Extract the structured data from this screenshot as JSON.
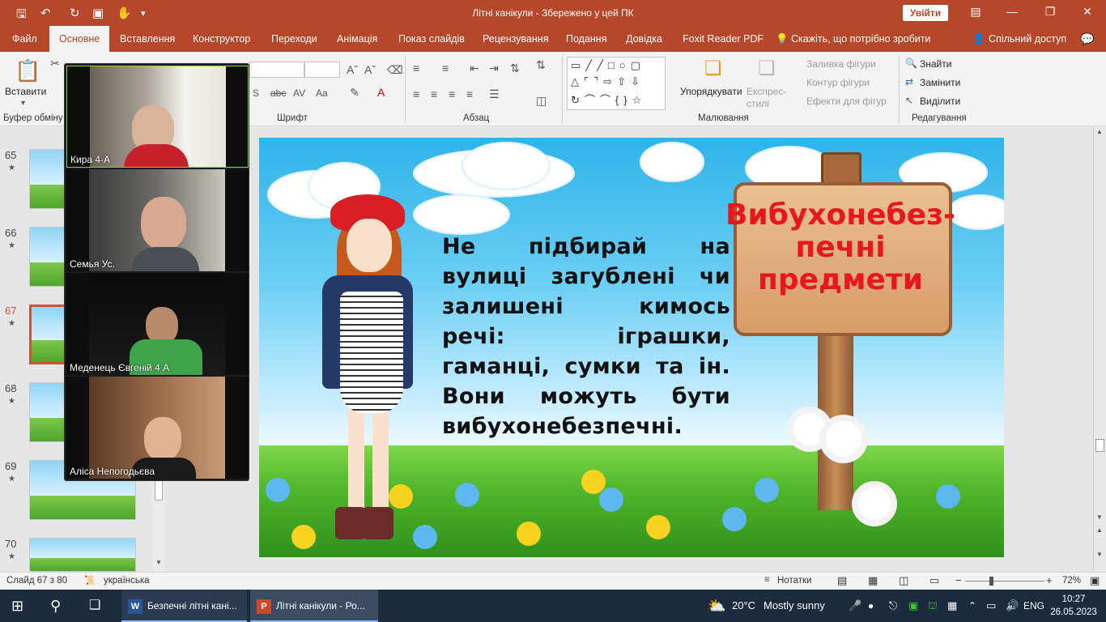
{
  "titlebar": {
    "title": "Літні канікули  -  Збережено у цей ПК",
    "signin_label": "Увійти"
  },
  "tabs": [
    "Файл",
    "Основне",
    "Вставлення",
    "Конструктор",
    "Переходи",
    "Анімація",
    "Показ слайдів",
    "Рецензування",
    "Подання",
    "Довідка",
    "Foxit Reader PDF",
    "Скажіть, що потрібно зробити",
    "Спільний доступ"
  ],
  "ribbon": {
    "paste_label": "Вставити",
    "clipboard_label": "Буфер обміну",
    "font_group": "Шрифт",
    "paragraph_group": "Абзац",
    "drawing_group": "Малювання",
    "editing_group": "Редагування",
    "arrange_label": "Упорядкувати",
    "quick_styles_label": "Експрес-стилі",
    "shape_fill": "Заливка фігури",
    "shape_outline": "Контур фігури",
    "shape_effects": "Ефекти для фігур",
    "find": "Знайти",
    "replace": "Замінити",
    "select": "Виділити"
  },
  "slides": [
    {
      "num": "65"
    },
    {
      "num": "66"
    },
    {
      "num": "67"
    },
    {
      "num": "68"
    },
    {
      "num": "69"
    },
    {
      "num": "70"
    }
  ],
  "slide": {
    "body_text": "Не підбирай на вулиці загублені чи залишені кимось речі: іграшки, гаманці, сумки та ін. Вони можуть бути вибухонебезпечні.",
    "sign_line1": "Вибухонебез-",
    "sign_line2": "печні",
    "sign_line3": "предмети"
  },
  "video": {
    "participants": [
      {
        "name": "Кира 4-А"
      },
      {
        "name": "Семья Ус."
      },
      {
        "name": "Меденець Євгеній 4 А"
      },
      {
        "name": "Аліса Непогодьєва"
      }
    ]
  },
  "status": {
    "slide_count": "Слайд 67 з 80",
    "language": "українська",
    "notes": "Нотатки",
    "zoom": "72%"
  },
  "taskbar": {
    "app1": "Безпечні літні кані...",
    "app2": "Літні канікули - Ро...",
    "weather_temp": "20°C",
    "weather_text": "Mostly sunny",
    "lang": "ENG",
    "time": "10:27",
    "date": "26.05.2023"
  },
  "colors": {
    "accent": "#b7472a",
    "sign_text": "#e8171b"
  }
}
